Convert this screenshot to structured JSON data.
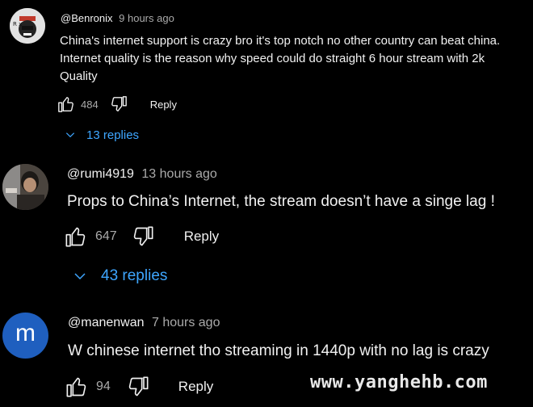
{
  "comments": [
    {
      "handle": "@Benronix",
      "time": "9 hours ago",
      "lines": [
        "China's internet support is crazy bro it's top notch no other country can beat china.",
        "Internet quality is the reason why speed could do straight 6 hour stream with 2k",
        "Quality"
      ],
      "likes": "484",
      "reply_label": "Reply",
      "replies_label": "13 replies",
      "avatar_text": "R x"
    },
    {
      "handle": "@rumi4919",
      "time": "13 hours ago",
      "lines": [
        "Props to China’s Internet, the stream doesn’t have a singe lag !"
      ],
      "likes": "647",
      "reply_label": "Reply",
      "replies_label": "43 replies"
    },
    {
      "handle": "@manenwan",
      "time": "7 hours ago",
      "lines": [
        "W chinese internet tho streaming in 1440p with no lag is crazy"
      ],
      "likes": "94",
      "reply_label": "Reply",
      "avatar_letter": "m"
    }
  ],
  "watermark": "www.yanghehb.com",
  "colors": {
    "background": "#000000",
    "text": "#f1f1f1",
    "secondary": "#aaaaaa",
    "link": "#3ea6ff",
    "avatar_m": "#1f5fbf"
  },
  "icons": [
    "thumbs-up-icon",
    "thumbs-down-icon",
    "chevron-down-icon"
  ]
}
